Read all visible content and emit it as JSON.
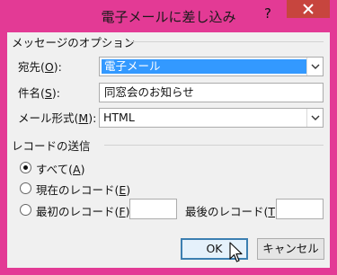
{
  "window": {
    "title": "電子メールに差し込み",
    "help": "?",
    "frame_color": "#e33a95"
  },
  "message_options": {
    "group_label": "メッセージのオプション",
    "to": {
      "label": "宛先(",
      "key": "O",
      "label_end": "):",
      "value": "電子メール"
    },
    "subject": {
      "label": "件名(",
      "key": "S",
      "label_end": "):",
      "value": "同窓会のお知らせ"
    },
    "format": {
      "label": "メール形式(",
      "key": "M",
      "label_end": "):",
      "value": "HTML"
    }
  },
  "send_records": {
    "group_label": "レコードの送信",
    "all": {
      "label": "すべて(",
      "key": "A",
      "label_end": ")",
      "selected": true
    },
    "current": {
      "label": "現在のレコード(",
      "key": "E",
      "label_end": ")",
      "selected": false
    },
    "from": {
      "label": "最初のレコード(",
      "key": "F",
      "label_end": "):",
      "selected": false,
      "value": ""
    },
    "to": {
      "label": "最後のレコード(",
      "key": "T",
      "label_end": "):",
      "value": ""
    }
  },
  "buttons": {
    "ok": "OK",
    "cancel": "キャンセル"
  },
  "icons": {
    "close": "close-icon",
    "dropdown": "chevron-down-icon",
    "cursor": "mouse-pointer-icon"
  }
}
